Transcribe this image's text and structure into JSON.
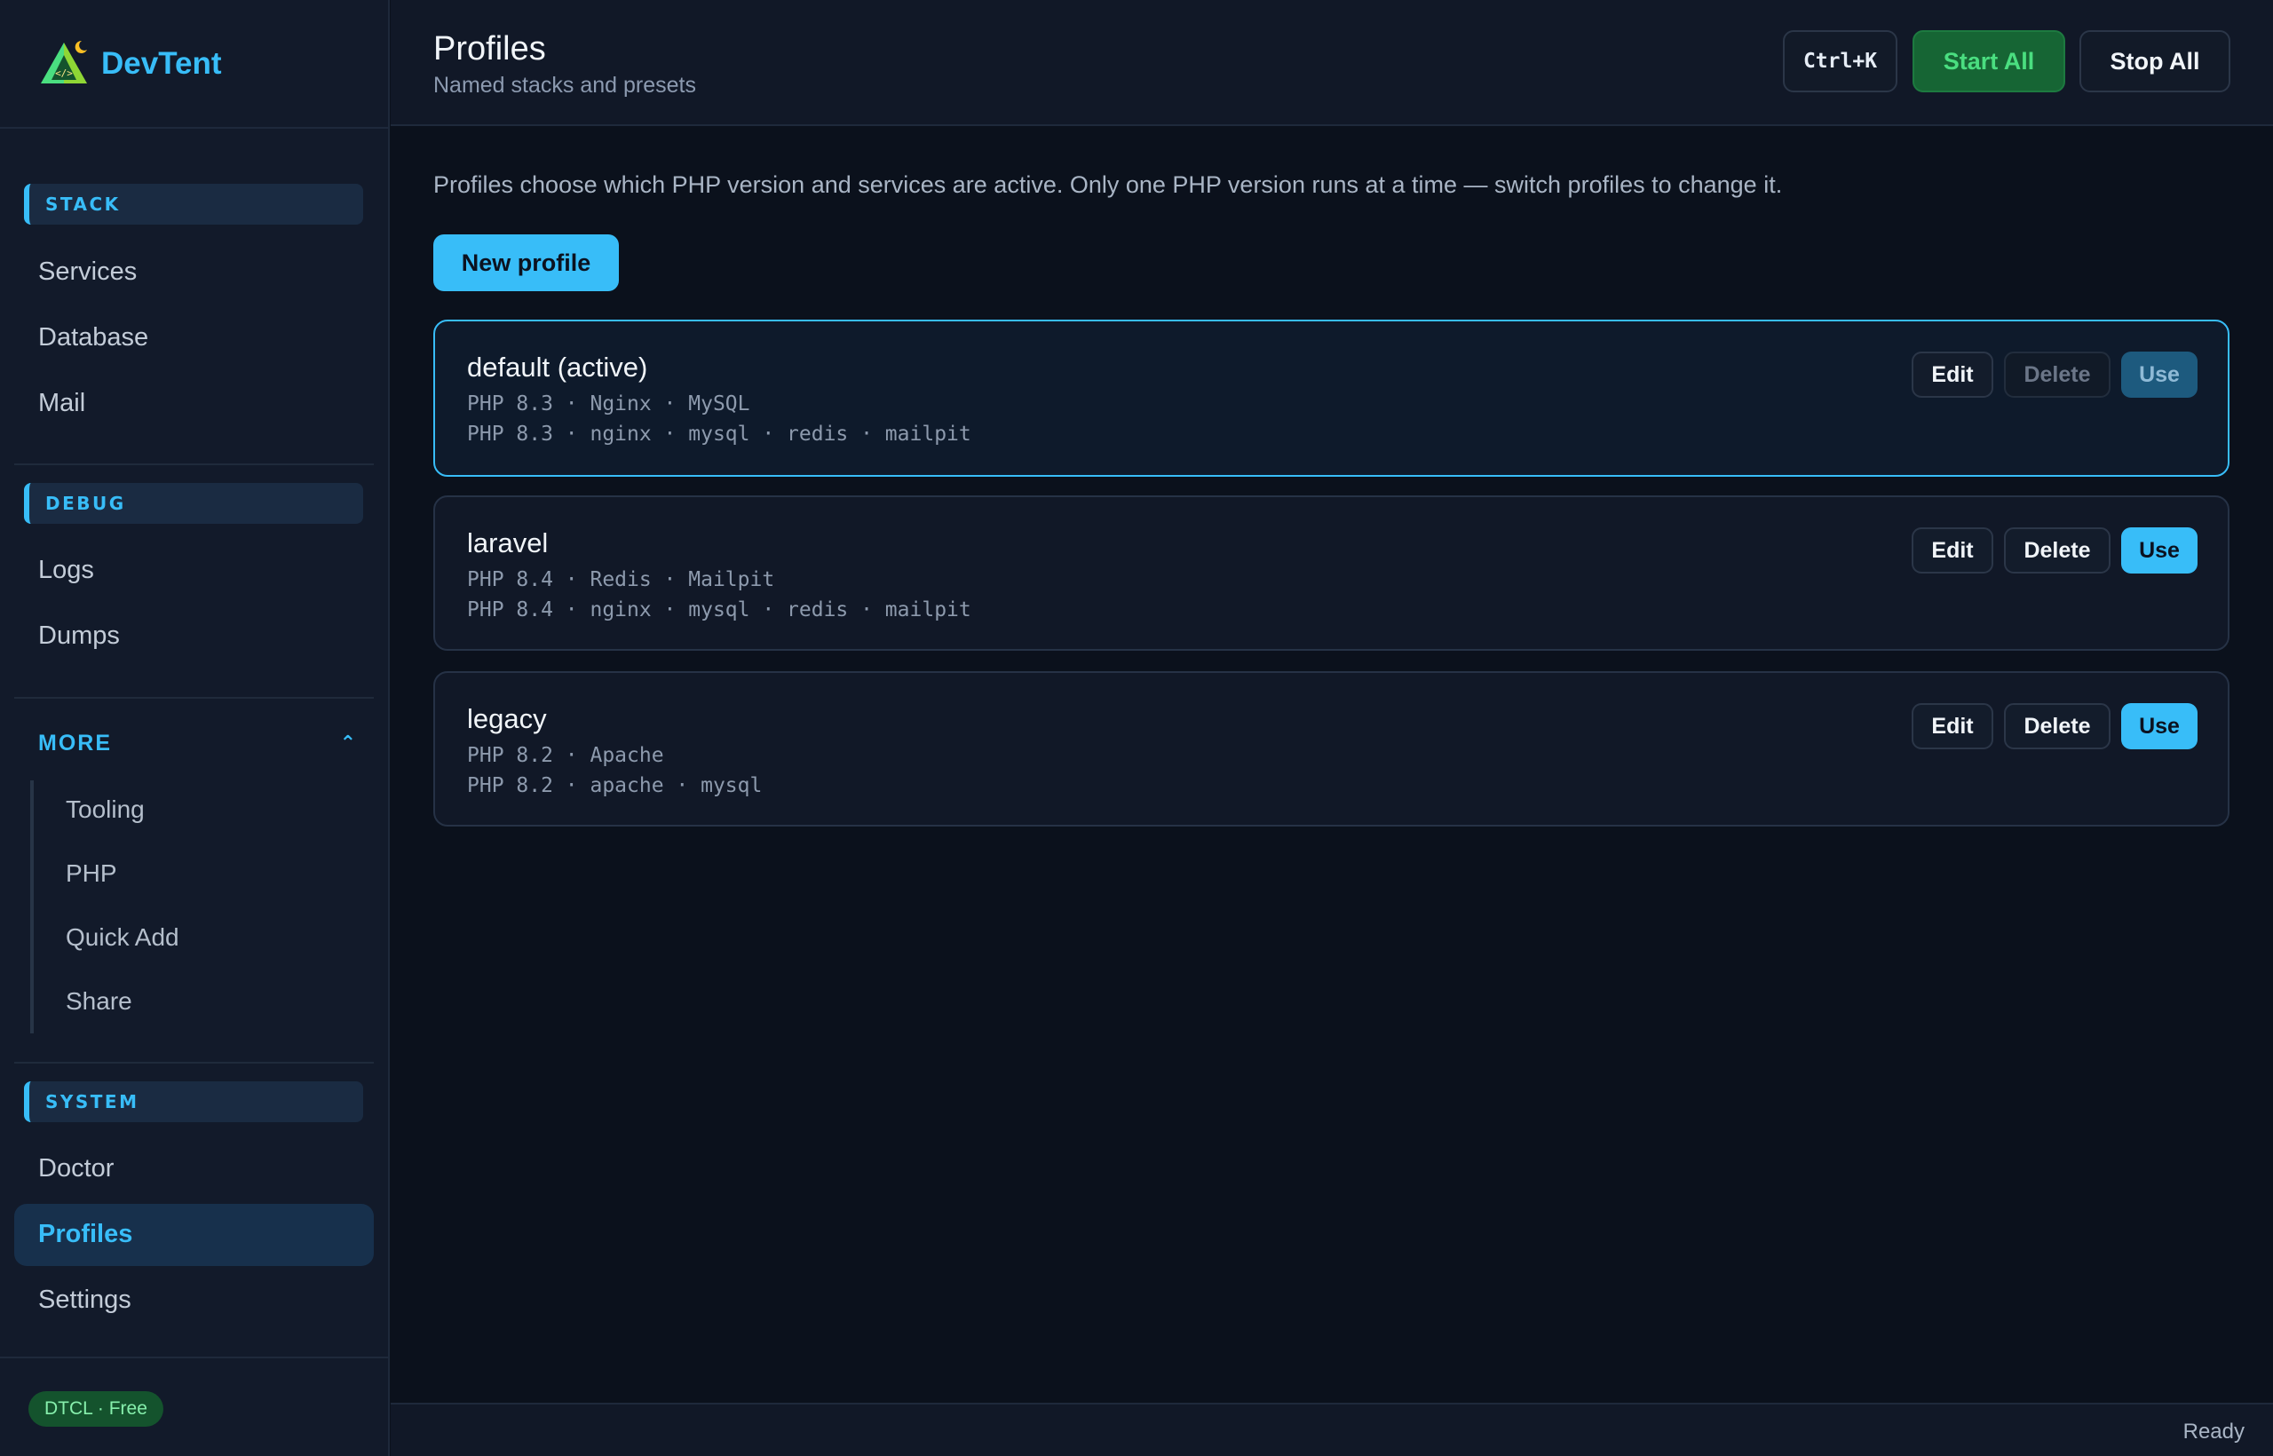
{
  "app": {
    "name": "DevTent",
    "plan_badge": "DTCL · Free",
    "status": "Ready"
  },
  "sidebar": {
    "sections": [
      {
        "label": "STACK",
        "items": [
          "Services",
          "Database",
          "Mail"
        ]
      },
      {
        "label": "DEBUG",
        "items": [
          "Logs",
          "Dumps"
        ]
      },
      {
        "label": "MORE",
        "collapsible": true,
        "expanded": true,
        "items": [
          "Tooling",
          "PHP",
          "Quick Add",
          "Share"
        ]
      },
      {
        "label": "SYSTEM",
        "items": [
          "Doctor",
          "Profiles",
          "Settings"
        ]
      }
    ],
    "active_item": "Profiles"
  },
  "header": {
    "title": "Profiles",
    "subtitle": "Named stacks and presets",
    "shortcut": "Ctrl+K",
    "start_all": "Start All",
    "stop_all": "Stop All"
  },
  "main": {
    "intro": "Profiles choose which PHP version and services are active. Only one PHP version runs at a time — switch profiles to change it.",
    "new_profile": "New profile",
    "profiles": [
      {
        "name": "default (active)",
        "summary": "PHP 8.3 · Nginx · MySQL",
        "services": "PHP 8.3 · nginx · mysql · redis · mailpit",
        "active": true,
        "edit": "Edit",
        "delete": "Delete",
        "use": "Use"
      },
      {
        "name": "laravel",
        "summary": "PHP 8.4 · Redis · Mailpit",
        "services": "PHP 8.4 · nginx · mysql · redis · mailpit",
        "active": false,
        "edit": "Edit",
        "delete": "Delete",
        "use": "Use"
      },
      {
        "name": "legacy",
        "summary": "PHP 8.2 · Apache",
        "services": "PHP 8.2 · apache · mysql",
        "active": false,
        "edit": "Edit",
        "delete": "Delete",
        "use": "Use"
      }
    ]
  },
  "colors": {
    "accent": "#38bdf8",
    "success": "#4ade80",
    "background": "#0b111c",
    "sidebar": "#121a2a"
  },
  "icons": {
    "logo": "tent-code-logo-icon",
    "more_toggle": "chevron-up-icon"
  }
}
